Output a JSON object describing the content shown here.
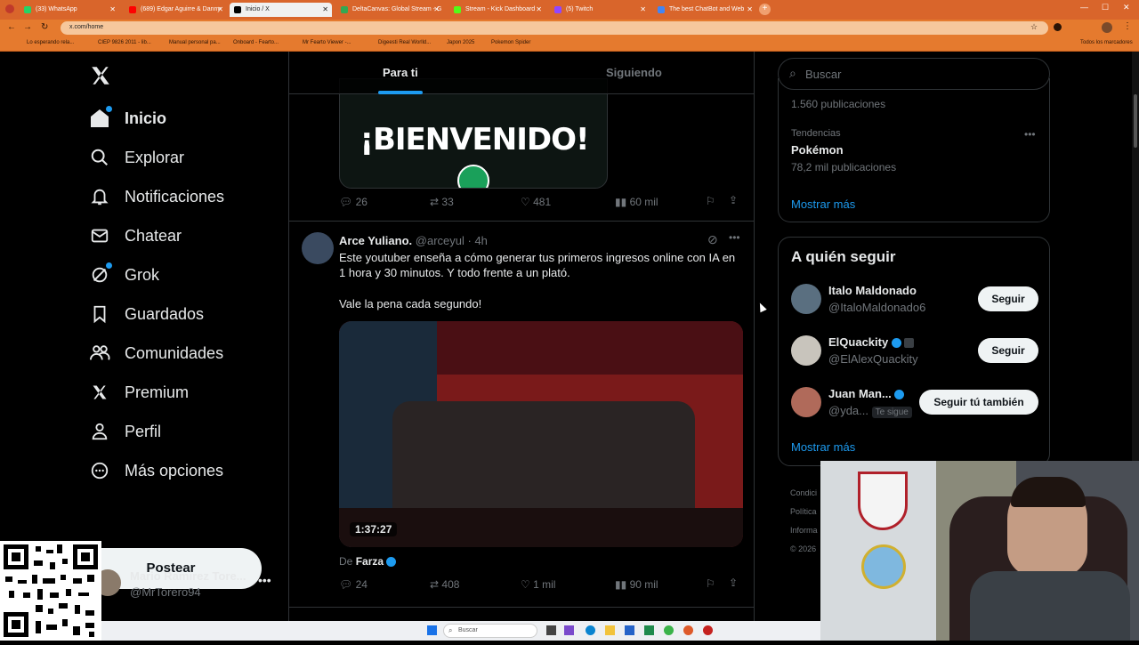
{
  "browser": {
    "tabs": [
      {
        "label": "(33) WhatsApp",
        "color": "#25d366"
      },
      {
        "label": "(689) Edgar Aguirre & Danny",
        "color": "#ff0000"
      },
      {
        "label": "Inicio / X",
        "color": "#000000"
      },
      {
        "label": "DeltaCanvas: Global Stream - G",
        "color": "#34a853"
      },
      {
        "label": "Stream - Kick Dashboard",
        "color": "#53fc18"
      },
      {
        "label": "(5) Twitch",
        "color": "#9146ff"
      },
      {
        "label": "The best ChatBot and Web",
        "color": "#4285f4"
      }
    ],
    "url": "x.com/home",
    "bookmarks": [
      "Lo esperando rela...",
      "CIEP 9826 2011 - lib...",
      "Manual personal pa...",
      "Onboard - Fearto...",
      "Mr Fearto Viewer -...",
      "Digeesti Real Worlld...",
      "Japon 2025",
      "Pokemon Spider"
    ],
    "bookmarks_right": "Todos los marcadores"
  },
  "nav": {
    "items": [
      {
        "label": "Inicio",
        "icon": "home-icon"
      },
      {
        "label": "Explorar",
        "icon": "search-icon"
      },
      {
        "label": "Notificaciones",
        "icon": "bell-icon"
      },
      {
        "label": "Chatear",
        "icon": "mail-icon"
      },
      {
        "label": "Grok",
        "icon": "grok-icon"
      },
      {
        "label": "Guardados",
        "icon": "bookmark-icon"
      },
      {
        "label": "Comunidades",
        "icon": "communities-icon"
      },
      {
        "label": "Premium",
        "icon": "x-logo-icon"
      },
      {
        "label": "Perfil",
        "icon": "person-icon"
      },
      {
        "label": "Más opciones",
        "icon": "more-circle-icon"
      }
    ],
    "post_label": "Postear",
    "account": {
      "name": "Mario Ramirez Tore...",
      "handle": "@MrTorero94"
    }
  },
  "feed": {
    "tabs": [
      "Para ti",
      "Siguiendo"
    ],
    "banner_text": "¡BIENVENIDO!",
    "post1_stats": {
      "replies": "26",
      "reposts": "33",
      "likes": "481",
      "views": "60 mil"
    },
    "post2": {
      "author": "Arce Yuliano.",
      "handle": "@arceyul",
      "time": "· 4h",
      "text1": "Este youtuber enseña a cómo generar tus primeros ingresos online con IA en 1 hora y 30 minutos. Y todo frente a un plató.",
      "text2": "Vale la pena cada segundo!",
      "video_duration": "1:37:27",
      "source_prefix": "De",
      "source_name": "Farza",
      "stats": {
        "replies": "24",
        "reposts": "408",
        "likes": "1 mil",
        "views": "90 mil"
      }
    }
  },
  "right": {
    "search_placeholder": "Buscar",
    "trends": {
      "prev_count": "1.560 publicaciones",
      "category": "Tendencias",
      "name": "Pokémon",
      "count": "78,2 mil publicaciones",
      "more": "Mostrar más"
    },
    "who_to_follow": {
      "title": "A quién seguir",
      "users": [
        {
          "name": "Italo Maldonado",
          "handle": "@ItaloMaldonado6",
          "button": "Seguir",
          "badge": ""
        },
        {
          "name": "ElQuackity",
          "handle": "@ElAlexQuackity",
          "button": "Seguir",
          "badge": ""
        },
        {
          "name": "Juan Man...",
          "handle": "@yda...",
          "button": "Seguir tú también",
          "badge": "Te sigue"
        }
      ],
      "more": "Mostrar más"
    },
    "footer_fragments": [
      "Condici",
      "Política",
      "Informa",
      "© 2026"
    ]
  },
  "taskbar": {
    "search_placeholder": "Buscar"
  },
  "colors": {
    "accent": "#1d9bf0",
    "tabbar": "#d9652b",
    "background": "#000000"
  }
}
